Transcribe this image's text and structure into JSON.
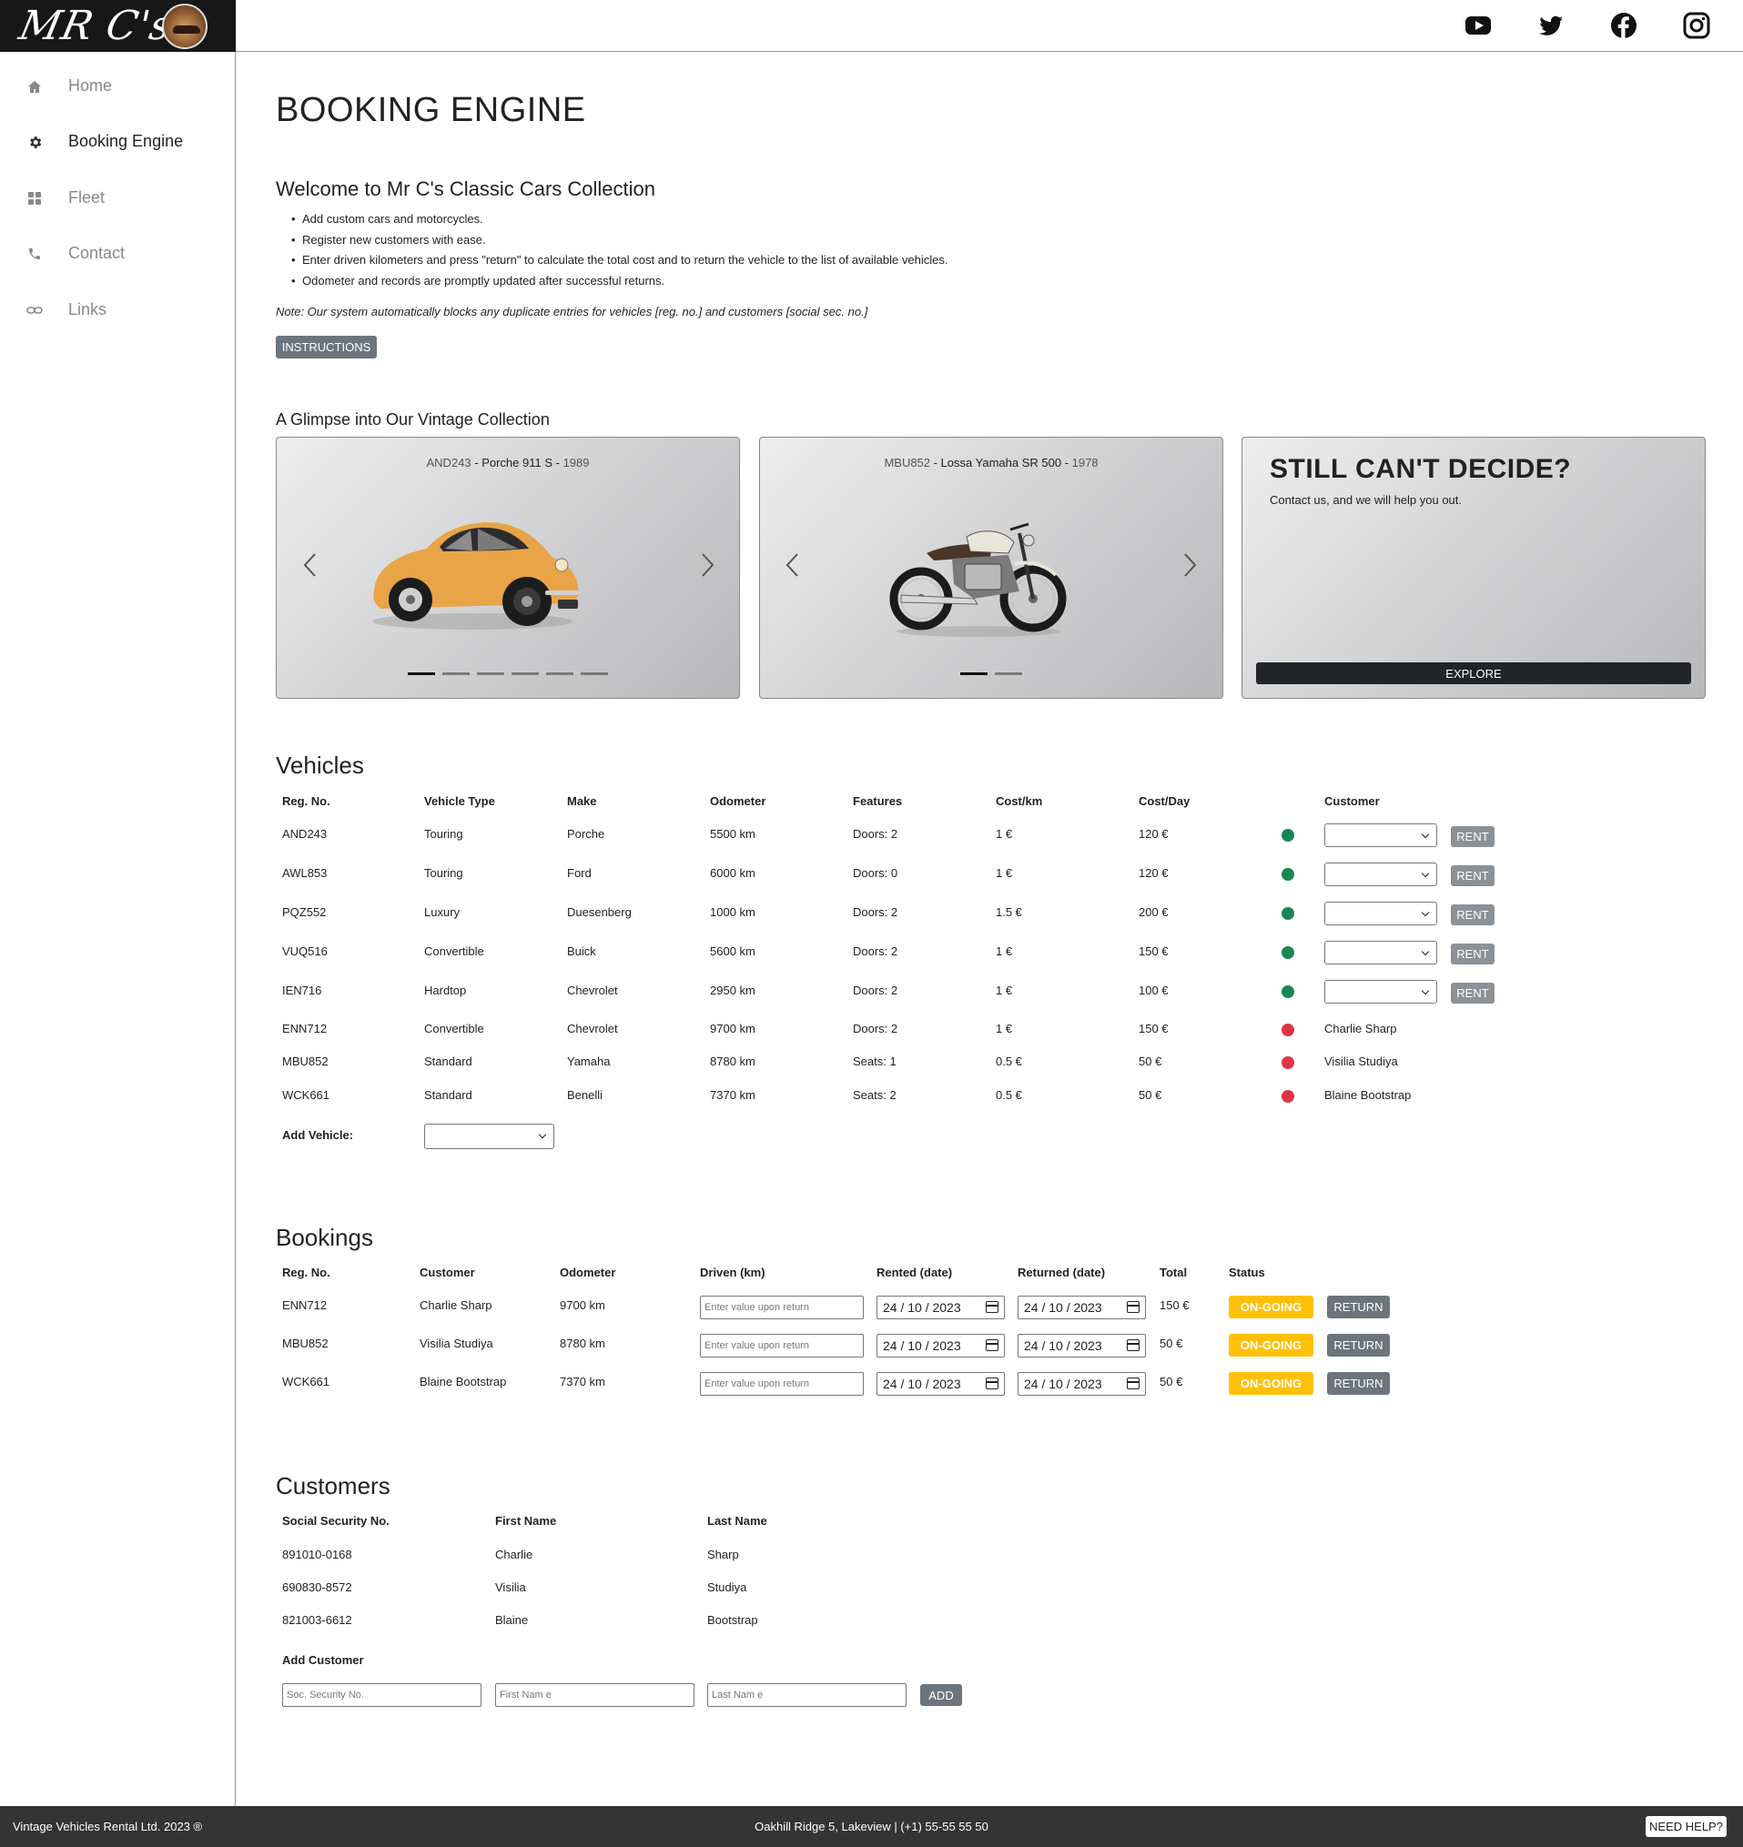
{
  "brand": {
    "logo_text": "MR C's"
  },
  "social": [
    "youtube-icon",
    "twitter-icon",
    "facebook-icon",
    "instagram-icon"
  ],
  "sidebar": {
    "items": [
      {
        "label": "Home",
        "icon": "home-icon"
      },
      {
        "label": "Booking Engine",
        "icon": "gear-icon"
      },
      {
        "label": "Fleet",
        "icon": "grid-icon"
      },
      {
        "label": "Contact",
        "icon": "phone-icon"
      },
      {
        "label": "Links",
        "icon": "link-icon"
      }
    ]
  },
  "page": {
    "title": "BOOKING ENGINE",
    "welcome": "Welcome to Mr C's Classic Cars Collection",
    "bullets": [
      "Add custom cars and motorcycles.",
      "Register new customers with ease.",
      "Enter driven kilometers and press \"return\" to calculate the total cost and to return the vehicle to the list of available vehicles.",
      "Odometer and records are promptly updated after successful returns."
    ],
    "note": "Note: Our system automatically blocks any duplicate entries for vehicles [reg. no.] and customers [social sec. no.]",
    "instructions_label": "INSTRUCTIONS"
  },
  "glimpse": {
    "title": "A Glimpse into Our Vintage Collection",
    "cards": [
      {
        "reg": "AND243",
        "sep1": " - ",
        "model": "Porche 911 S",
        "sep2": " - ",
        "year": "1989"
      },
      {
        "reg": "MBU852",
        "sep1": " - ",
        "model": "Lossa Yamaha SR 500",
        "sep2": " - ",
        "year": "1978"
      }
    ],
    "decide": {
      "title": "STILL CAN'T DECIDE?",
      "text": "Contact us, and we will help you out.",
      "button": "EXPLORE"
    }
  },
  "vehicles": {
    "title": "Vehicles",
    "headers": [
      "Reg. No.",
      "Vehicle Type",
      "Make",
      "Odometer",
      "Features",
      "Cost/km",
      "Cost/Day",
      "Customer"
    ],
    "rows": [
      {
        "reg": "AND243",
        "type": "Touring",
        "make": "Porche",
        "odo": "5500 km",
        "features": "Doors: 2",
        "cost_km": "1 €",
        "cost_day": "120 €",
        "status": "available",
        "customer": ""
      },
      {
        "reg": "AWL853",
        "type": "Touring",
        "make": "Ford",
        "odo": "6000 km",
        "features": "Doors: 0",
        "cost_km": "1 €",
        "cost_day": "120 €",
        "status": "available",
        "customer": ""
      },
      {
        "reg": "PQZ552",
        "type": "Luxury",
        "make": "Duesenberg",
        "odo": "1000 km",
        "features": "Doors: 2",
        "cost_km": "1.5 €",
        "cost_day": "200 €",
        "status": "available",
        "customer": ""
      },
      {
        "reg": "VUQ516",
        "type": "Convertible",
        "make": "Buick",
        "odo": "5600 km",
        "features": "Doors: 2",
        "cost_km": "1 €",
        "cost_day": "150 €",
        "status": "available",
        "customer": ""
      },
      {
        "reg": "IEN716",
        "type": "Hardtop",
        "make": "Chevrolet",
        "odo": "2950 km",
        "features": "Doors: 2",
        "cost_km": "1 €",
        "cost_day": "100 €",
        "status": "available",
        "customer": ""
      },
      {
        "reg": "ENN712",
        "type": "Convertible",
        "make": "Chevrolet",
        "odo": "9700 km",
        "features": "Doors: 2",
        "cost_km": "1 €",
        "cost_day": "150 €",
        "status": "rented",
        "customer": "Charlie Sharp"
      },
      {
        "reg": "MBU852",
        "type": "Standard",
        "make": "Yamaha",
        "odo": "8780 km",
        "features": "Seats: 1",
        "cost_km": "0.5 €",
        "cost_day": "50 €",
        "status": "rented",
        "customer": "Visilia Studiya"
      },
      {
        "reg": "WCK661",
        "type": "Standard",
        "make": "Benelli",
        "odo": "7370 km",
        "features": "Seats: 2",
        "cost_km": "0.5 €",
        "cost_day": "50 €",
        "status": "rented",
        "customer": "Blaine Bootstrap"
      }
    ],
    "rent_label": "RENT",
    "add_label": "Add Vehicle:",
    "status_colors": {
      "available": "#198754",
      "rented": "#dc3545"
    }
  },
  "bookings": {
    "title": "Bookings",
    "headers": [
      "Reg. No.",
      "Customer",
      "Odometer",
      "Driven (km)",
      "Rented (date)",
      "Returned (date)",
      "Total",
      "Status"
    ],
    "driven_placeholder": "Enter value upon return",
    "status_label": "ON-GOING",
    "return_label": "RETURN",
    "rows": [
      {
        "reg": "ENN712",
        "customer": "Charlie Sharp",
        "odo": "9700 km",
        "rented": "24 / 10 / 2023",
        "returned": "24 / 10 / 2023",
        "total": "150 €"
      },
      {
        "reg": "MBU852",
        "customer": "Visilia Studiya",
        "odo": "8780 km",
        "rented": "24 / 10 / 2023",
        "returned": "24 / 10 / 2023",
        "total": "50 €"
      },
      {
        "reg": "WCK661",
        "customer": "Blaine Bootstrap",
        "odo": "7370 km",
        "rented": "24 / 10 / 2023",
        "returned": "24 / 10 / 2023",
        "total": "50 €"
      }
    ]
  },
  "customers": {
    "title": "Customers",
    "headers": [
      "Social Security No.",
      "First Name",
      "Last Name"
    ],
    "rows": [
      {
        "ssn": "891010-0168",
        "first": "Charlie",
        "last": "Sharp"
      },
      {
        "ssn": "690830-8572",
        "first": "Visilia",
        "last": "Studiya"
      },
      {
        "ssn": "821003-6612",
        "first": "Blaine",
        "last": "Bootstrap"
      }
    ],
    "add_title": "Add Customer",
    "ssn_placeholder": "Soc. Security No.",
    "first_placeholder": "First Nam e",
    "last_placeholder": "Last Nam e",
    "add_label": "ADD"
  },
  "footer": {
    "left": "Vintage Vehicles Rental Ltd. 2023 ®",
    "center": "Oakhill Ridge 5, Lakeview | (+1) 55-55 55 50",
    "help": "NEED HELP?"
  }
}
